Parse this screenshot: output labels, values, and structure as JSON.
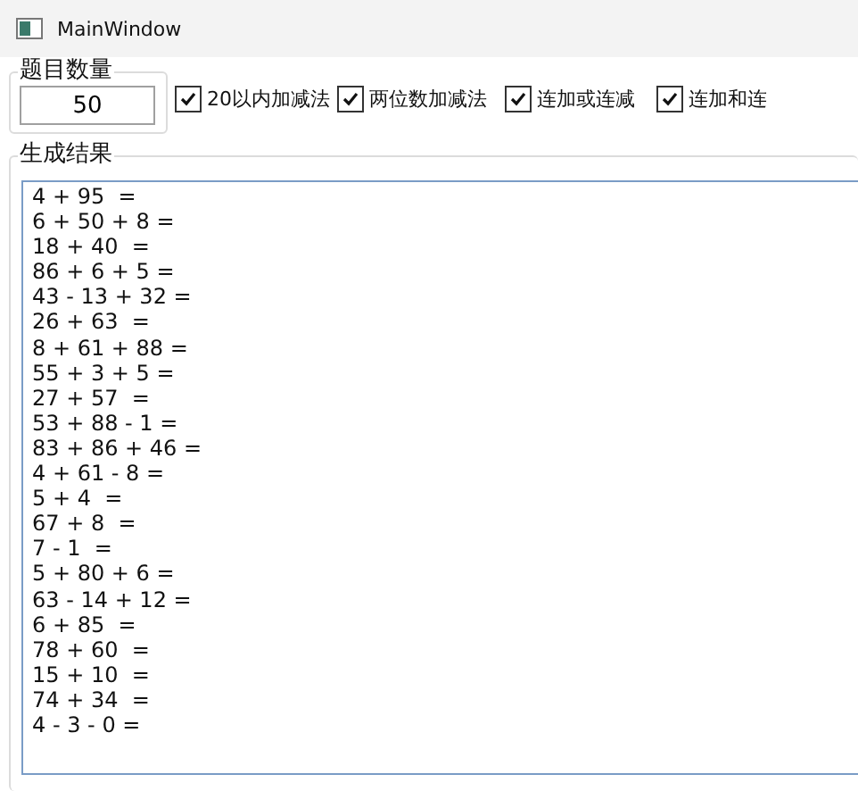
{
  "window": {
    "title": "MainWindow"
  },
  "count_group": {
    "label": "题目数量",
    "value": "50"
  },
  "options": [
    {
      "label": "20以内加减法",
      "checked": true
    },
    {
      "label": "两位数加减法",
      "checked": true
    },
    {
      "label": "连加或连减",
      "checked": true
    },
    {
      "label": "连加和连",
      "checked": true
    }
  ],
  "results": {
    "label": "生成结果",
    "lines": [
      "4 + 95  =",
      "6 + 50 + 8 =",
      "18 + 40  =",
      "86 + 6 + 5 =",
      "43 - 13 + 32 =",
      "26 + 63  =",
      "8 + 61 + 88 =",
      "55 + 3 + 5 =",
      "27 + 57  =",
      "53 + 88 - 1 =",
      "83 + 86 + 46 =",
      "4 + 61 - 8 =",
      "5 + 4  =",
      "67 + 8  =",
      "7 - 1  =",
      "5 + 80 + 6 =",
      "63 - 14 + 12 =",
      "6 + 85  =",
      "78 + 60  =",
      "15 + 10  =",
      "74 + 34  =",
      "4 - 3 - 0 ="
    ]
  }
}
